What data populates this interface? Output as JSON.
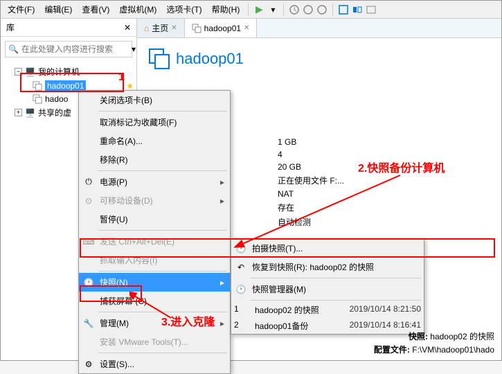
{
  "menubar": {
    "file": "文件(F)",
    "edit": "编辑(E)",
    "view": "查看(V)",
    "vm": "虚拟机(M)",
    "tabs": "选项卡(T)",
    "help": "帮助(H)"
  },
  "sidebar": {
    "title": "库",
    "search_placeholder": "在此处键入内容进行搜索",
    "my_computer": "我的计算机",
    "vm1": "hadoop01",
    "vm2": "hadoo",
    "shared": "共享的虚"
  },
  "tabs": {
    "home": "主页",
    "vm": "hadoop01"
  },
  "main": {
    "title": "hadoop01"
  },
  "ctx1": {
    "close_tab": "关闭选项卡(B)",
    "mark_fav": "取消标记为收藏项(F)",
    "rename": "重命名(A)...",
    "remove": "移除(R)",
    "power": "电源(P)",
    "removable": "可移动设备(D)",
    "pause": "暂停(U)",
    "send_cad": "发送 Ctrl+Alt+Del(E)",
    "grab_input": "抓取输入内容(I)",
    "snapshot": "快照(N)",
    "capture": "捕获屏幕 (C)",
    "manage": "管理(M)",
    "install_tools": "安装 VMware Tools(T)...",
    "settings": "设置(S)..."
  },
  "ctx2": {
    "take_snapshot": "拍摄快照(T)...",
    "revert": "恢复到快照(R): hadoop02 的快照",
    "snapshot_mgr": "快照管理器(M)"
  },
  "details": {
    "mem": "1 GB",
    "cpu": "4",
    "disk": "20 GB",
    "using_file": "正在使用文件 F:...",
    "network": "NAT",
    "present": "存在",
    "auto_detect": "自动检测"
  },
  "annotations": {
    "label1": "1",
    "label2": "2.快照备份计算机",
    "label3": "3.进入克隆"
  },
  "snapshots": {
    "row1_num": "1",
    "row1_name": "hadoop02 的快照",
    "row1_date": "2019/10/14 8:21:50",
    "row2_num": "2",
    "row2_name": "hadoop01备份",
    "row2_date": "2019/10/14 8:16:41"
  },
  "footer": {
    "snapshot_label": "快照:",
    "snapshot_val": "hadoop02 的快照",
    "config_label": "配置文件:",
    "config_val": "F:\\VM\\hadoop01\\hado"
  }
}
